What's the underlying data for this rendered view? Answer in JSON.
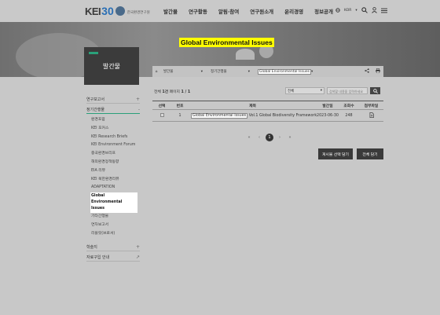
{
  "header": {
    "logo_text": "KEI",
    "logo_number": "30",
    "logo_subtitle": "한국환경연구원",
    "nav": [
      "발간물",
      "연구활동",
      "알림·참여",
      "연구원소개",
      "윤리경영",
      "정보공개"
    ],
    "lang": "KOR"
  },
  "hero": {
    "title": "Global Environmental Issues"
  },
  "sidebar": {
    "title": "발간물",
    "menu": [
      {
        "label": "연구보고서",
        "sign": "+"
      },
      {
        "label": "정기간행물",
        "sign": "-"
      }
    ],
    "submenu": [
      "환경포럼",
      "KEI 포커스",
      "KEI Research Briefs",
      "KEI Environment Forum",
      "중국환경브리프",
      "해외환경정책동향",
      "EIA 리뷰",
      "KEI 북한환경리뷰",
      "ADAPTATION",
      "Global Environmental Issues",
      "기타간행물",
      "연차보고서",
      "리플릿(브로셔)"
    ],
    "after": [
      {
        "label": "학술지",
        "sign": "+"
      },
      {
        "label": "자료구입 안내",
        "sign": "↗"
      }
    ]
  },
  "breadcrumb": {
    "level1": "발간물",
    "level2": "정기간행물",
    "level3": "Global Environmental Issues"
  },
  "list": {
    "total_label": "전체",
    "total_count": "1건",
    "page_label": "페이지",
    "page_value": "1 / 1",
    "search_select": "전체",
    "search_placeholder": "검색할 내용을 입력하세요",
    "columns": [
      "선택",
      "번호",
      "제목",
      "발간일",
      "조회수",
      "첨부파일"
    ],
    "rows": [
      {
        "no": "1",
        "title_highlight": "Global Environmental Issues",
        "title_rest": " Vol.1 Global Biodiversity Framework",
        "date": "2023-06-30",
        "views": "248"
      }
    ]
  },
  "pagination": {
    "current": "1"
  },
  "buttons": {
    "select_download": "게시물 선택 담기",
    "all_download": "전체 담기"
  },
  "colors": {
    "accent": "#2aa07a",
    "highlight": "#ffff00",
    "dark": "#3a3a3a"
  }
}
